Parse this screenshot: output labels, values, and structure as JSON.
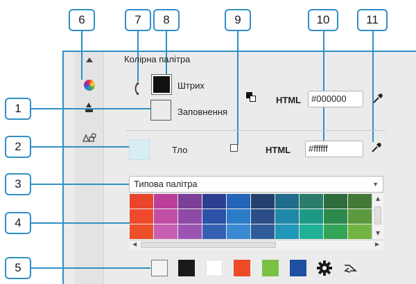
{
  "callouts": {
    "c1": "1",
    "c2": "2",
    "c3": "3",
    "c4": "4",
    "c5": "5",
    "c6": "6",
    "c7": "7",
    "c8": "8",
    "c9": "9",
    "c10": "10",
    "c11": "11"
  },
  "panel": {
    "title": "Колірна палітра",
    "stroke_label": "Штрих",
    "fill_label": "Заповнення",
    "html_label_1": "HTML",
    "stroke_hex": "#000000",
    "background_label": "Тло",
    "html_label_2": "HTML",
    "background_hex": "#ffffff",
    "palette_name": "Типова палітра"
  },
  "sidebar_icons": [
    "arrow-up-icon",
    "color-wheel-icon",
    "fill-bucket-icon",
    "shapes-icon"
  ],
  "colors": {
    "callout_border": "#2f8fc6",
    "stroke_swatch": "#111111",
    "background_swatch": "#d8eef6"
  },
  "palette_rows": [
    [
      "#e8452c",
      "#bb3f9a",
      "#7c3f98",
      "#2c3e8f",
      "#2464b8",
      "#24406f",
      "#216c8c",
      "#2b7d6b",
      "#2e6b3e",
      "#437a37"
    ],
    [
      "#f04a2e",
      "#c14ea5",
      "#8e4aa6",
      "#2d52a8",
      "#2a7bc8",
      "#2a4d86",
      "#1f88a8",
      "#1c9a86",
      "#2b8a4c",
      "#5a9a3c"
    ],
    [
      "#ee4f2b",
      "#c95fb0",
      "#9a55b2",
      "#3560b2",
      "#3a8ad3",
      "#2f5c98",
      "#2196b6",
      "#1fb096",
      "#31a457",
      "#72b441"
    ]
  ],
  "recent_colors": [
    "#ffffff",
    "#1a1a1a",
    "#ffffff",
    "#ee4a25",
    "#7ac143",
    "#1f4fa3"
  ]
}
